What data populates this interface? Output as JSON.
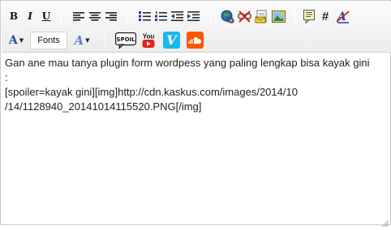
{
  "toolbar": {
    "bold_label": "B",
    "italic_label": "I",
    "underline_label": "U",
    "font_color_letter": "A",
    "fonts_label": "Fonts",
    "font_size_letter": "A",
    "hash_label": "#",
    "spoiler_label": "SPOIL",
    "youtube_label": "You",
    "vimeo_letter": "V",
    "icons": [
      "align-left-icon",
      "align-center-icon",
      "align-right-icon",
      "bullet-list-icon",
      "numbered-list-icon",
      "outdent-icon",
      "indent-icon",
      "link-icon",
      "unlink-icon",
      "email-icon",
      "image-icon",
      "quote-icon",
      "code-icon",
      "remove-format-icon",
      "spoiler-icon",
      "youtube-icon",
      "vimeo-icon",
      "soundcloud-icon"
    ]
  },
  "editor": {
    "content": "Gan ane mau tanya plugin form wordpess yang paling lengkap bisa kayak gini :\n[spoiler=kayak gini][img]http://cdn.kaskus.com/images/2014/10\n/14/1128940_20141014115520.PNG[/img]"
  },
  "colors": {
    "toolbar_bg": "#f2f2f2",
    "border": "#c9c9c9",
    "text": "#222222",
    "youtube_red": "#e62117",
    "vimeo_blue": "#1ab7ea",
    "soundcloud_orange": "#ff5500"
  }
}
